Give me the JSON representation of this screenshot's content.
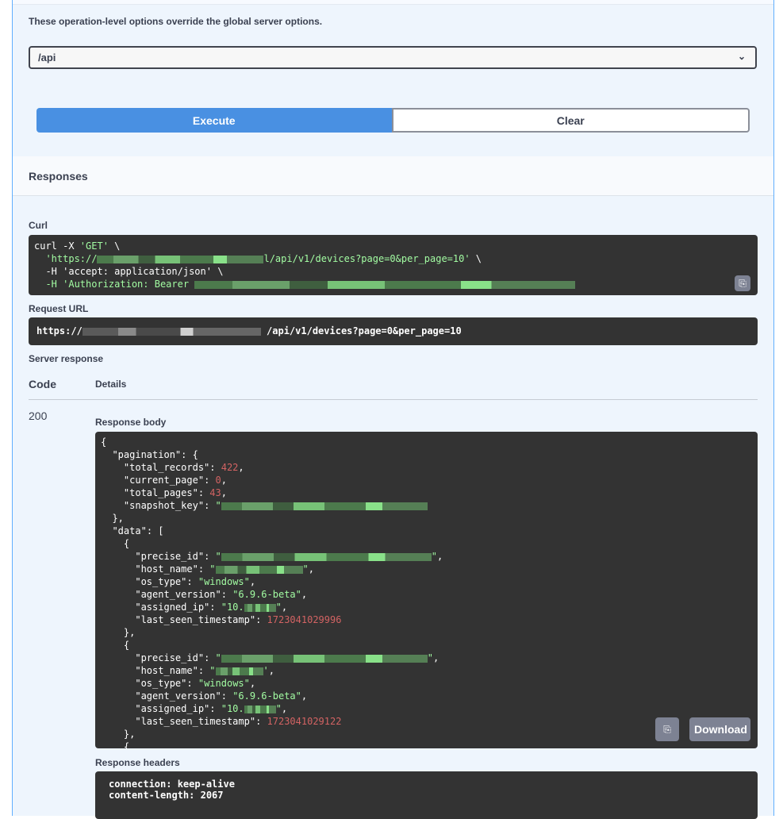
{
  "servers": {
    "description": "These operation-level options override the global server options.",
    "selected": "/api",
    "chevron_icon": "chevron-down-icon"
  },
  "actions": {
    "execute_label": "Execute",
    "clear_label": "Clear"
  },
  "responses": {
    "title": "Responses",
    "curl_label": "Curl",
    "curl": {
      "line1_prefix": "curl -X ",
      "line1_method": "'GET'",
      "line1_suffix": " \\",
      "line2_prefix": "'https://",
      "line2_suffix": "l/api/v1/devices?page=0&per_page=10'",
      "line2_tail": " \\",
      "line3": "-H 'accept: application/json' \\",
      "line4": "-H 'Authorization: Bearer "
    },
    "request_url_label": "Request URL",
    "request_url_prefix": "https://",
    "request_url_suffix": "/api/v1/devices?page=0&per_page=10",
    "server_response_label": "Server response",
    "table": {
      "code_header": "Code",
      "details_header": "Details",
      "status_code": "200"
    },
    "response_body_label": "Response body",
    "body": {
      "pagination_key": "\"pagination\"",
      "total_records_key": "\"total_records\"",
      "total_records": "422",
      "current_page_key": "\"current_page\"",
      "current_page": "0",
      "total_pages_key": "\"total_pages\"",
      "total_pages": "43",
      "snapshot_key_key": "\"snapshot_key\"",
      "data_key": "\"data\"",
      "records": [
        {
          "os_type": "\"windows\"",
          "agent_version": "\"6.9.6-beta\"",
          "assigned_ip_prefix": "\"10.",
          "last_seen_timestamp": "1723041029996"
        },
        {
          "os_type": "\"windows\"",
          "agent_version": "\"6.9.6-beta\"",
          "assigned_ip_prefix": "\"10.",
          "last_seen_timestamp": "1723041029122"
        }
      ],
      "field_keys": {
        "precise_id": "\"precise_id\"",
        "host_name": "\"host_name\"",
        "os_type": "\"os_type\"",
        "agent_version": "\"agent_version\"",
        "assigned_ip": "\"assigned_ip\"",
        "last_seen_timestamp": "\"last_seen_timestamp\""
      }
    },
    "download_label": "Download",
    "response_headers_label": "Response headers",
    "headers": [
      "connection: keep-alive",
      "content-length: 2067"
    ]
  }
}
